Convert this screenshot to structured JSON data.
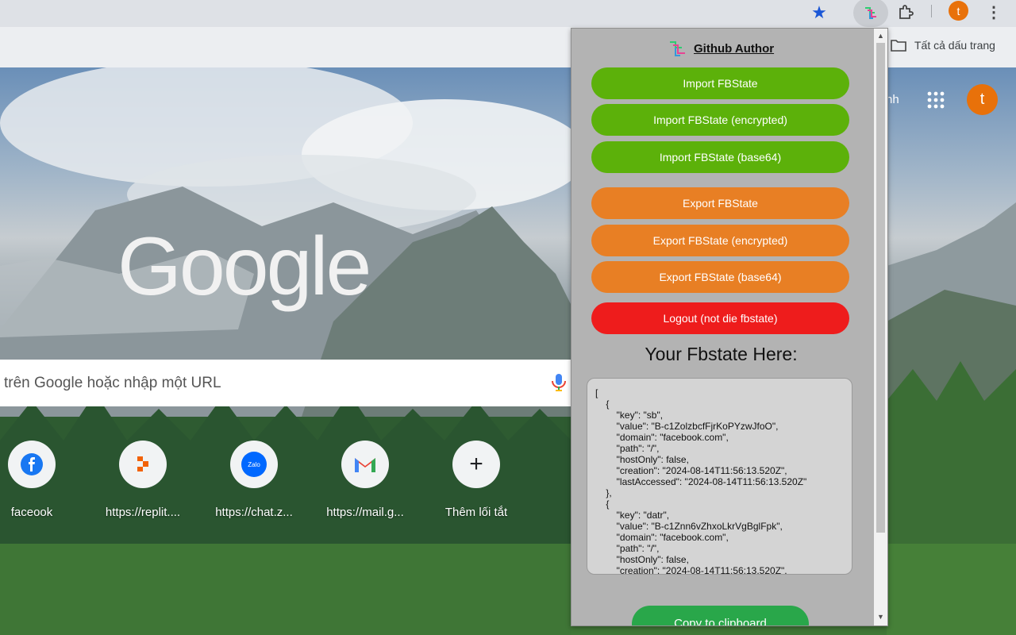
{
  "browser": {
    "bookmark_folder_label": "Tất cả dấu trang",
    "profile_initial": "t"
  },
  "newtab": {
    "logo_text": "Google",
    "search_placeholder": "trên Google hoặc nhập một URL",
    "partial_link": "nh",
    "shortcuts": [
      {
        "label": "faceook",
        "icon": "facebook-icon"
      },
      {
        "label": "https://replit....",
        "icon": "replit-icon"
      },
      {
        "label": "https://chat.z...",
        "icon": "zalo-icon"
      },
      {
        "label": "https://mail.g...",
        "icon": "gmail-icon"
      },
      {
        "label": "Thêm lối tắt",
        "icon": "add-icon"
      }
    ],
    "zalo_text": "Zalo"
  },
  "popup": {
    "author_label": "Github Author",
    "buttons": {
      "import": "Import FBState",
      "import_encrypted": "Import FBState (encrypted)",
      "import_base64": "Import FBState (base64)",
      "export": "Export FBState",
      "export_encrypted": "Export FBState (encrypted)",
      "export_base64": "Export FBState (base64)",
      "logout": "Logout (not die fbstate)"
    },
    "heading": "Your Fbstate Here:",
    "fbstate_json": "[\n    {\n        \"key\": \"sb\",\n        \"value\": \"B-c1ZolzbcfFjrKoPYzwJfoO\",\n        \"domain\": \"facebook.com\",\n        \"path\": \"/\",\n        \"hostOnly\": false,\n        \"creation\": \"2024-08-14T11:56:13.520Z\",\n        \"lastAccessed\": \"2024-08-14T11:56:13.520Z\"\n    },\n    {\n        \"key\": \"datr\",\n        \"value\": \"B-c1Znn6vZhxoLkrVgBglFpk\",\n        \"domain\": \"facebook.com\",\n        \"path\": \"/\",\n        \"hostOnly\": false,\n        \"creation\": \"2024-08-14T11:56:13.520Z\",",
    "copy_button": "Copy to clipboard"
  },
  "colors": {
    "green_button": "#5cb10a",
    "orange_button": "#e87f24",
    "red_button": "#ee1c1c",
    "copy_button": "#29a74a",
    "profile": "#e8710a"
  }
}
